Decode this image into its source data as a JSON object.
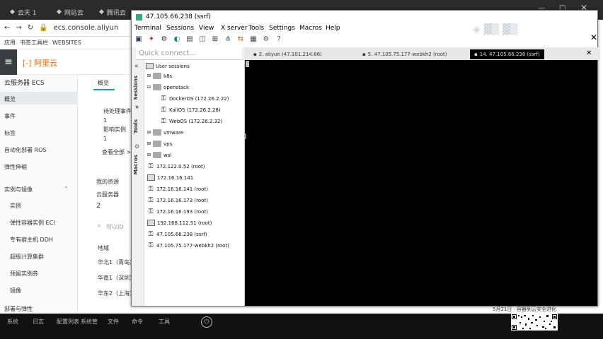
{
  "browser": {
    "tabs": [
      "云天 1",
      "网站云",
      "腾讯云"
    ],
    "address": "ecs.console.aliyun",
    "bookmarks": [
      "应用",
      "书签工具栏",
      "WEBSITES"
    ]
  },
  "aliyun": {
    "logo": "阿里云",
    "section_title": "云服务器 ECS",
    "tab": "概览",
    "sidebar": [
      "概览",
      "事件",
      "标签",
      "自动化部署 ROS",
      "弹性伸缩",
      "实例与镜像",
      "实例",
      "弹性容器实例 ECI",
      "专有宿主机 DDH",
      "超级计算集群",
      "预留实例券",
      "镜像",
      "部署与弹性"
    ],
    "main": {
      "pending": "待处理事件",
      "count1": "1",
      "affected": "影响实例",
      "count2": "1",
      "view_all": "查看全部 >",
      "my_resources": "我的资源",
      "servers": "云服务器",
      "server_count": "2",
      "search_placeholder": "可以ID",
      "region_label": "地域",
      "regions": [
        "华北1（青岛）",
        "华南1（深圳）",
        "华东2（上海）"
      ]
    }
  },
  "moba": {
    "title": "47.105.66.238 (ssrf)",
    "menu": [
      "Terminal",
      "Sessions",
      "View",
      "X server",
      "Tools",
      "Settings",
      "Macros",
      "Help"
    ],
    "quick_connect": "Quick connect...",
    "tabs": [
      {
        "label": "2. aliyun (47.101.214.86)",
        "active": false
      },
      {
        "label": "5. 47.105.75.177-webkh2 (root)",
        "active": false
      },
      {
        "label": "14. 47.105.66.238 (ssrf)",
        "active": true
      }
    ],
    "vertical_tabs": [
      "Sessions",
      "Tools",
      "Macros"
    ],
    "tree": {
      "root": "User sessions",
      "folders": [
        "k8s",
        "openstack",
        "vmware",
        "vps",
        "wsl"
      ],
      "openstack_children": [
        "DockerOS (172.26.2.22)",
        "KaliOS (172.26.2.28)",
        "WebOS (172.26.2.32)"
      ],
      "sessions": [
        "172.122.0.52 (root)",
        "172.16.16.141",
        "172.16.16.141 (root)",
        "172.16.16.173 (root)",
        "172.16.16.193 (root)",
        "192.168.112.51 (root)",
        "47.105.66.238 (ssrf)",
        "47.105.75.177-webkh2 (root)"
      ]
    }
  },
  "overlay": {
    "caption": "5月21日 · 容器到云安全进化"
  },
  "taskbar": [
    "系统",
    "日志",
    "配置列表",
    "系统管",
    "文件",
    "命令",
    "工具"
  ]
}
